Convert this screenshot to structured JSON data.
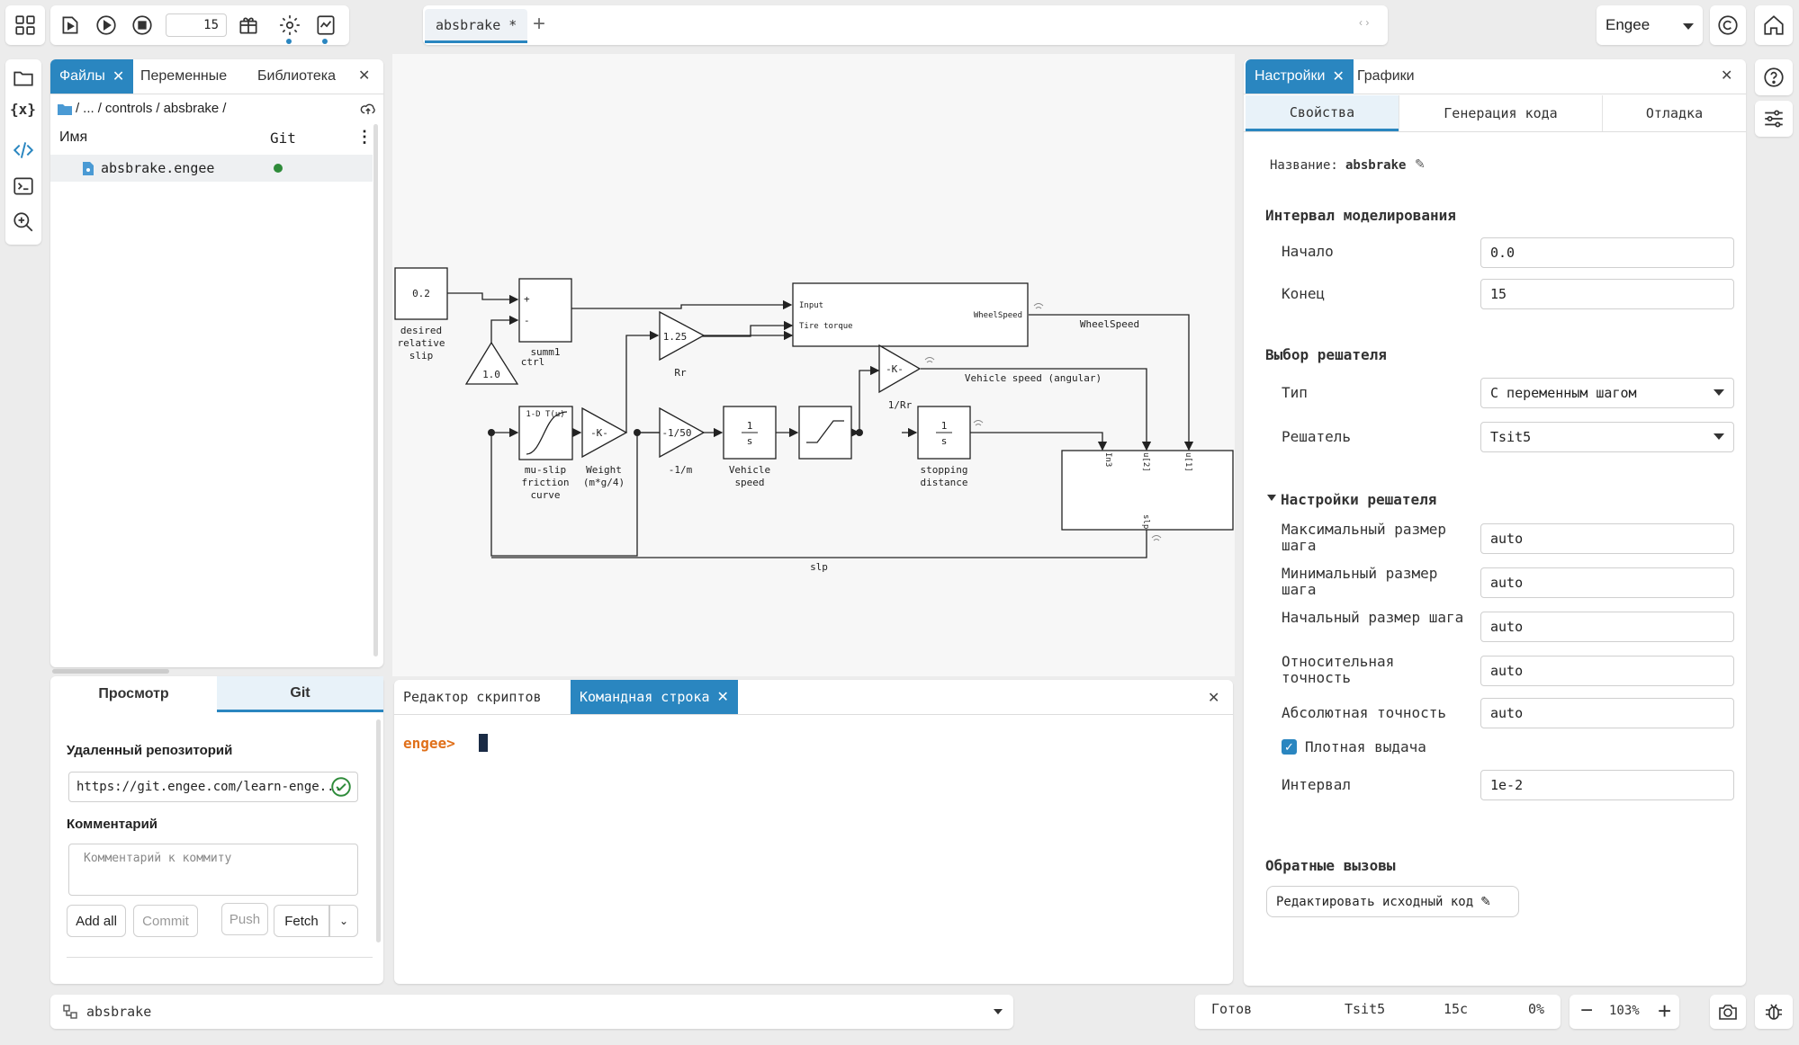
{
  "toolbar": {
    "step_value": "15",
    "file_tab": "absbrake *",
    "account": "Engee"
  },
  "left_panel": {
    "tabs": [
      "Файлы",
      "Переменные",
      "Библиотека"
    ],
    "breadcrumb": [
      "/",
      "...",
      "/",
      "controls",
      "/",
      "absbrake",
      "/"
    ],
    "col_name": "Имя",
    "col_git": "Git",
    "file": "absbrake.engee"
  },
  "git_panel": {
    "tabs": [
      "Просмотр",
      "Git"
    ],
    "remote_label": "Удаленный репозиторий",
    "remote_url": "https://git.engee.com/learn-enge...",
    "comment_label": "Комментарий",
    "comment_placeholder": "Комментарий к коммиту",
    "buttons": {
      "add_all": "Add all",
      "commit": "Commit",
      "push": "Push",
      "fetch": "Fetch"
    }
  },
  "diagram": {
    "blocks": {
      "desired_value": "0.2",
      "desired_label": [
        "desired",
        "relative",
        "slip"
      ],
      "summ_label": [
        "summ1",
        "ctrl"
      ],
      "gain_1": "1.0",
      "gain_rr": "1.25",
      "gain_rr_label": "Rr",
      "wheel_inputs": [
        "Input",
        "Tire torque"
      ],
      "wheel_output": "WheelSpeed",
      "wheelspeed_signal": "WheelSpeed",
      "gain_k": "-K-",
      "gain_k_label": "1/Rr",
      "vehicle_speed_signal": "Vehicle speed (angular)",
      "lookup_title": "1-D T(u)",
      "lookup_label": [
        "mu-slip",
        "friction",
        "curve"
      ],
      "weight": "-K-",
      "weight_label": [
        "Weight",
        "(m*g/4)"
      ],
      "gain_m": "-1/50",
      "gain_m_label": "-1/m",
      "int1_label": [
        "Vehicle",
        "speed"
      ],
      "int2_label": [
        "stopping",
        "distance"
      ],
      "int_num": "1",
      "int_den": "s",
      "sub_ports": [
        "In3",
        "u[2]",
        "u[1]"
      ],
      "sub_out": "slp",
      "slp_signal": "slp"
    }
  },
  "console": {
    "tabs": [
      "Редактор скриптов",
      "Командная строка"
    ],
    "prompt": "engee>"
  },
  "settings": {
    "tabs": [
      "Настройки",
      "Графики"
    ],
    "subtabs": [
      "Свойства",
      "Генерация кода",
      "Отладка"
    ],
    "name_label": "Название:",
    "name_value": "absbrake",
    "interval_header": "Интервал моделирования",
    "start_label": "Начало",
    "start_value": "0.0",
    "end_label": "Конец",
    "end_value": "15",
    "solver_header": "Выбор решателя",
    "type_label": "Тип",
    "type_value": "С переменным шагом",
    "solver_label": "Решатель",
    "solver_value": "Tsit5",
    "solver_settings_header": "Настройки решателя",
    "max_step_label": "Максимальный размер шага",
    "max_step_value": "auto",
    "min_step_label": "Минимальный размер шага",
    "min_step_value": "auto",
    "init_step_label": "Начальный размер шага",
    "init_step_value": "auto",
    "rel_tol_label": "Относительная точность",
    "rel_tol_value": "auto",
    "abs_tol_label": "Абсолютная точность",
    "abs_tol_value": "auto",
    "dense_label": "Плотная выдача",
    "interval_label": "Интервал",
    "interval_value": "1e-2",
    "callbacks_header": "Обратные вызовы",
    "edit_code_button": "Редактировать исходный код"
  },
  "status": {
    "model": "absbrake",
    "state": "Готов",
    "solver": "Tsit5",
    "time": "15c",
    "progress": "0%",
    "zoom": "103%"
  },
  "colors": {
    "accent": "#2a86c0",
    "prompt": "#e0701a",
    "git_ok": "#2e8b3a"
  }
}
